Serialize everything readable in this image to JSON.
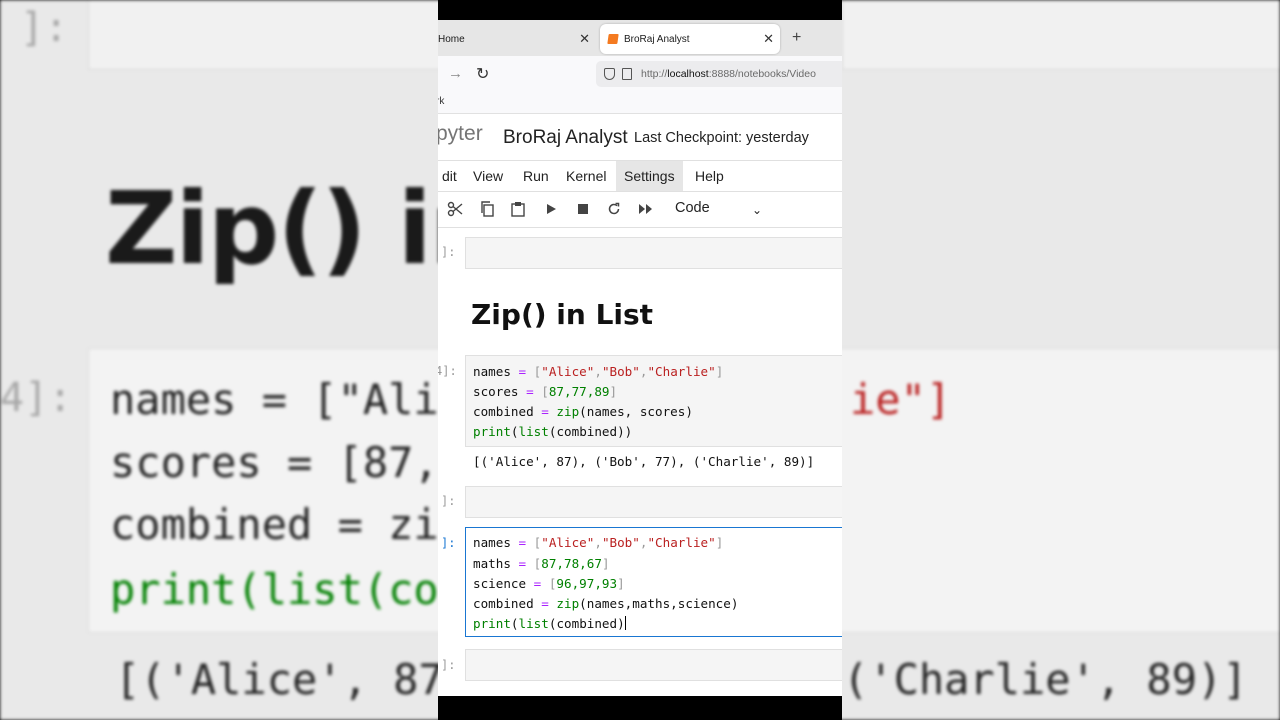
{
  "browser": {
    "tabs": [
      {
        "label": "Home"
      },
      {
        "label": "BroRaj Analyst"
      }
    ],
    "url_prefix": "http://",
    "url_host": "localhost",
    "url_rest": ":8888/notebooks/Video",
    "bookmark_fragment": "rk"
  },
  "jupyter": {
    "logo_fragment": "pyter",
    "notebook_title": "BroRaj Analyst",
    "checkpoint": "Last Checkpoint: yesterday",
    "menu": [
      "dit",
      "View",
      "Run",
      "Kernel",
      "Settings",
      "Help"
    ],
    "active_menu": "Settings",
    "cell_type": "Code",
    "toolbar_icons": [
      "scissors-icon",
      "copy-icon",
      "paste-icon",
      "run-icon",
      "stop-icon",
      "restart-icon",
      "fast-forward-icon"
    ]
  },
  "notebook": {
    "empty_prompt": "]:",
    "executed_prompt": "4]:",
    "heading": "Zip() in List",
    "cell1": {
      "line1": {
        "var": "names",
        "op": " = ",
        "ob": "[",
        "s1": "\"Alice\"",
        "c1": ",",
        "s2": "\"Bob\"",
        "c2": ",",
        "s3": "\"Charlie\"",
        "cb": "]"
      },
      "line2": {
        "var": "scores",
        "op": " = ",
        "ob": "[",
        "vals": "87,77,89",
        "cb": "]"
      },
      "line3": {
        "var": "combined",
        "op": " = ",
        "fn": "zip",
        "args": "(names, scores)"
      },
      "line4": {
        "fn1": "print",
        "p1": "(",
        "fn2": "list",
        "args": "(combined))"
      },
      "output": "[('Alice', 87), ('Bob', 77), ('Charlie', 89)]"
    },
    "cell2": {
      "line1": {
        "var": "names",
        "op": " = ",
        "ob": "[",
        "s1": "\"Alice\"",
        "c1": ",",
        "s2": "\"Bob\"",
        "c2": ",",
        "s3": "\"Charlie\"",
        "cb": "]"
      },
      "line2": {
        "var": "maths",
        "op": " = ",
        "ob": "[",
        "vals": "87,78,67",
        "cb": "]"
      },
      "line3": {
        "var": "science",
        "op": " = ",
        "ob": "[",
        "vals": "96,97,93",
        "cb": "]"
      },
      "line4": {
        "var": "combined",
        "op": " = ",
        "fn": "zip",
        "args": "(names,maths,science)"
      },
      "line5": {
        "fn1": "print",
        "p1": "(",
        "fn2": "list",
        "args": "(combined)"
      }
    }
  },
  "background": {
    "heading": "Zip() in",
    "prompt_top": "]:",
    "prompt_code": "4]:",
    "line1": "names = [\"Ali",
    "line1_right": "ie\"]",
    "line2": "scores = [87,",
    "line3": "combined = zi",
    "line4": "print(list(co",
    "out_left": "[('Alice', 87",
    "out_right": "('Charlie', 89)]"
  },
  "colors": {
    "accent_blue": "#1976d2",
    "keyword_green": "#008000",
    "string_red": "#ba2121",
    "operator_purple": "#aa22ff",
    "jupyter_orange": "#f47a20"
  }
}
